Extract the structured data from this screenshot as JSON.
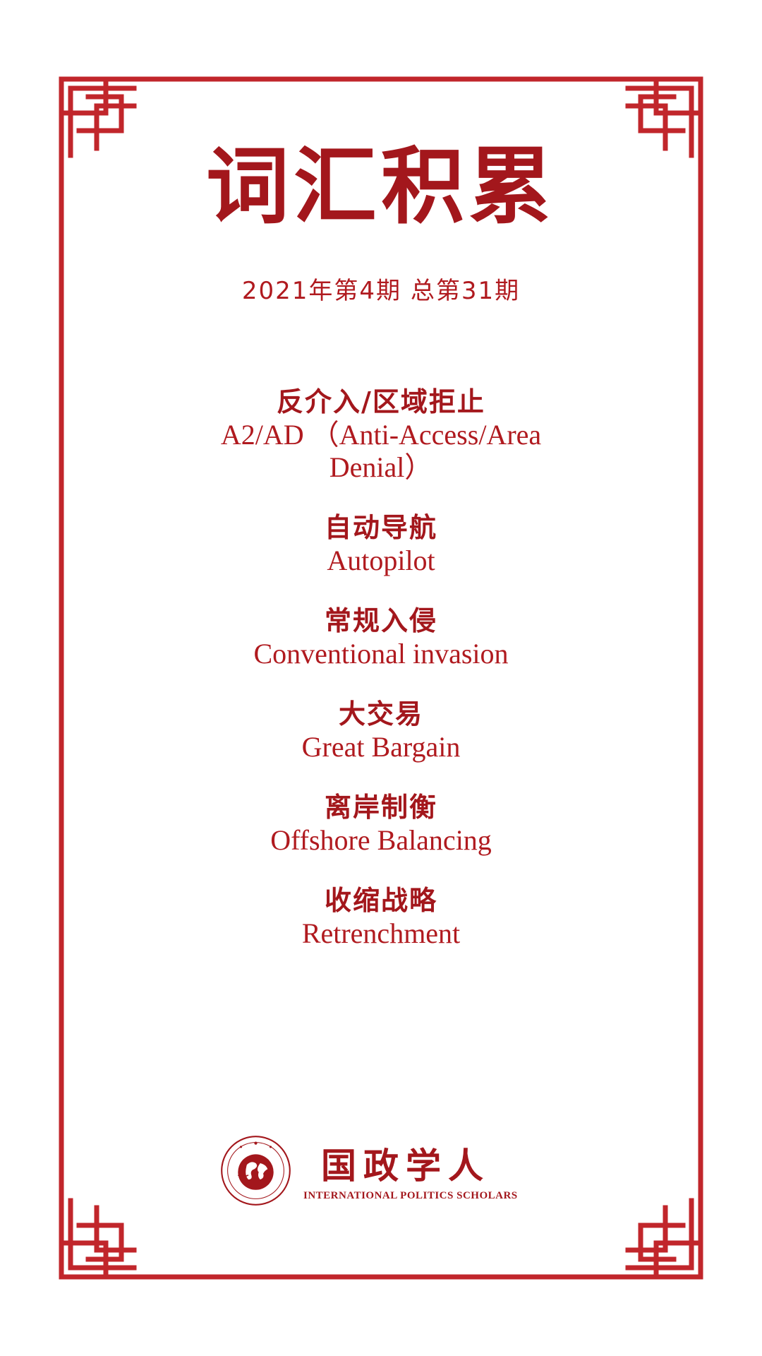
{
  "colors": {
    "frame": "#c1262b",
    "text": "#b01a1f",
    "title": "#a3171c"
  },
  "title": "词汇积累",
  "issue": "2021年第4期 总第31期",
  "terms": [
    {
      "zh": "反介入/区域拒止",
      "en": "A2/AD （Anti-Access/Area Denial）"
    },
    {
      "zh": "自动导航",
      "en": "Autopilot"
    },
    {
      "zh": "常规入侵",
      "en": "Conventional invasion"
    },
    {
      "zh": "大交易",
      "en": "Great Bargain"
    },
    {
      "zh": "离岸制衡",
      "en": "Offshore Balancing"
    },
    {
      "zh": "收缩战略",
      "en": "Retrenchment"
    }
  ],
  "logo": {
    "icon": "globe-seal-icon",
    "name": "国政学人",
    "subtitle": "INTERNATIONAL POLITICS SCHOLARS"
  }
}
